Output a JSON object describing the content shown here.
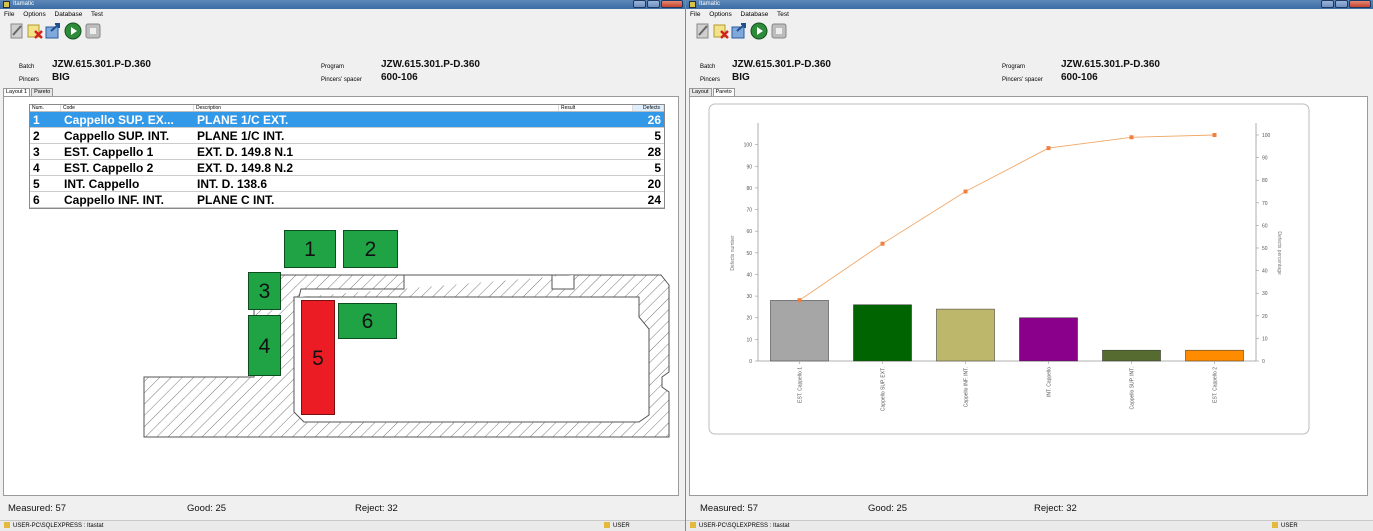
{
  "left": {
    "window_title": "Itamatic",
    "menu": [
      "File",
      "Options",
      "Database",
      "Test"
    ],
    "batch_label": "Batch",
    "batch_value": "JZW.615.301.P-D.360",
    "pincers_label": "Pincers",
    "pincers_value": "BIG",
    "program_label": "Program",
    "program_value": "JZW.615.301.P-D.360",
    "spacer_label": "Pincers' spacer",
    "spacer_value": "600-106",
    "tabs": [
      "Layout 1",
      "Pareto"
    ],
    "grid": {
      "headers": [
        "Num.",
        "Code",
        "Description",
        "Result",
        "Defects"
      ],
      "rows": [
        {
          "num": "1",
          "code": "Cappello SUP. EX...",
          "desc": "PLANE 1/C EXT.",
          "result": "",
          "defects": "26"
        },
        {
          "num": "2",
          "code": "Cappello SUP. INT.",
          "desc": "PLANE 1/C INT.",
          "result": "",
          "defects": "5"
        },
        {
          "num": "3",
          "code": "EST. Cappello 1",
          "desc": "EXT. D. 149.8 N.1",
          "result": "",
          "defects": "28"
        },
        {
          "num": "4",
          "code": "EST. Cappello 2",
          "desc": "EXT. D. 149.8 N.2",
          "result": "",
          "defects": "5"
        },
        {
          "num": "5",
          "code": "INT. Cappello",
          "desc": "INT. D. 138.6",
          "result": "",
          "defects": "20"
        },
        {
          "num": "6",
          "code": "Cappello INF. INT.",
          "desc": "PLANE C INT.",
          "result": "",
          "defects": "24"
        }
      ]
    },
    "blocks": [
      "1",
      "2",
      "3",
      "4",
      "5",
      "6"
    ],
    "measured": "Measured: 57",
    "good": "Good: 25",
    "reject": "Reject: 32",
    "status_text": "USER-PC\\SQLEXPRESS : Itastat",
    "status_user": "USER"
  },
  "right": {
    "window_title": "Itamatic",
    "menu": [
      "File",
      "Options",
      "Database",
      "Test"
    ],
    "batch_label": "Batch",
    "batch_value": "JZW.615.301.P-D.360",
    "pincers_label": "Pincers",
    "pincers_value": "BIG",
    "program_label": "Program",
    "program_value": "JZW.615.301.P-D.360",
    "spacer_label": "Pincers' spacer",
    "spacer_value": "600-106",
    "tabs": [
      "Layout",
      "Pareto"
    ],
    "measured": "Measured: 57",
    "good": "Good: 25",
    "reject": "Reject: 32",
    "status_text": "USER-PC\\SQLEXPRESS : Itastat",
    "status_user": "USER"
  },
  "chart_data": {
    "type": "bar",
    "categories": [
      "EST. Cappello 1",
      "Cappello SUP. EXT.",
      "Cappello INF. INT.",
      "INT. Cappello",
      "Cappello SUP. INT.",
      "EST. Cappello 2"
    ],
    "values": [
      28,
      26,
      24,
      20,
      5,
      5
    ],
    "bar_colors": [
      "#a6a6a6",
      "#006400",
      "#bdb76b",
      "#8b008b",
      "#556b2f",
      "#ff8c00"
    ],
    "cumulative_percent": [
      26.9,
      51.9,
      75.0,
      94.2,
      99.0,
      100
    ],
    "line_color": "#f0a868",
    "ylabel": "Defects number",
    "y2label": "Defects percentage",
    "ylim": [
      0,
      110
    ],
    "y2lim": [
      0,
      100
    ],
    "yticks": [
      "0",
      "10",
      "20",
      "30",
      "40",
      "50",
      "60",
      "70",
      "80",
      "90",
      "100"
    ],
    "y2ticks": [
      "0",
      "10",
      "20",
      "30",
      "40",
      "50",
      "60",
      "70",
      "80",
      "90",
      "100"
    ]
  }
}
